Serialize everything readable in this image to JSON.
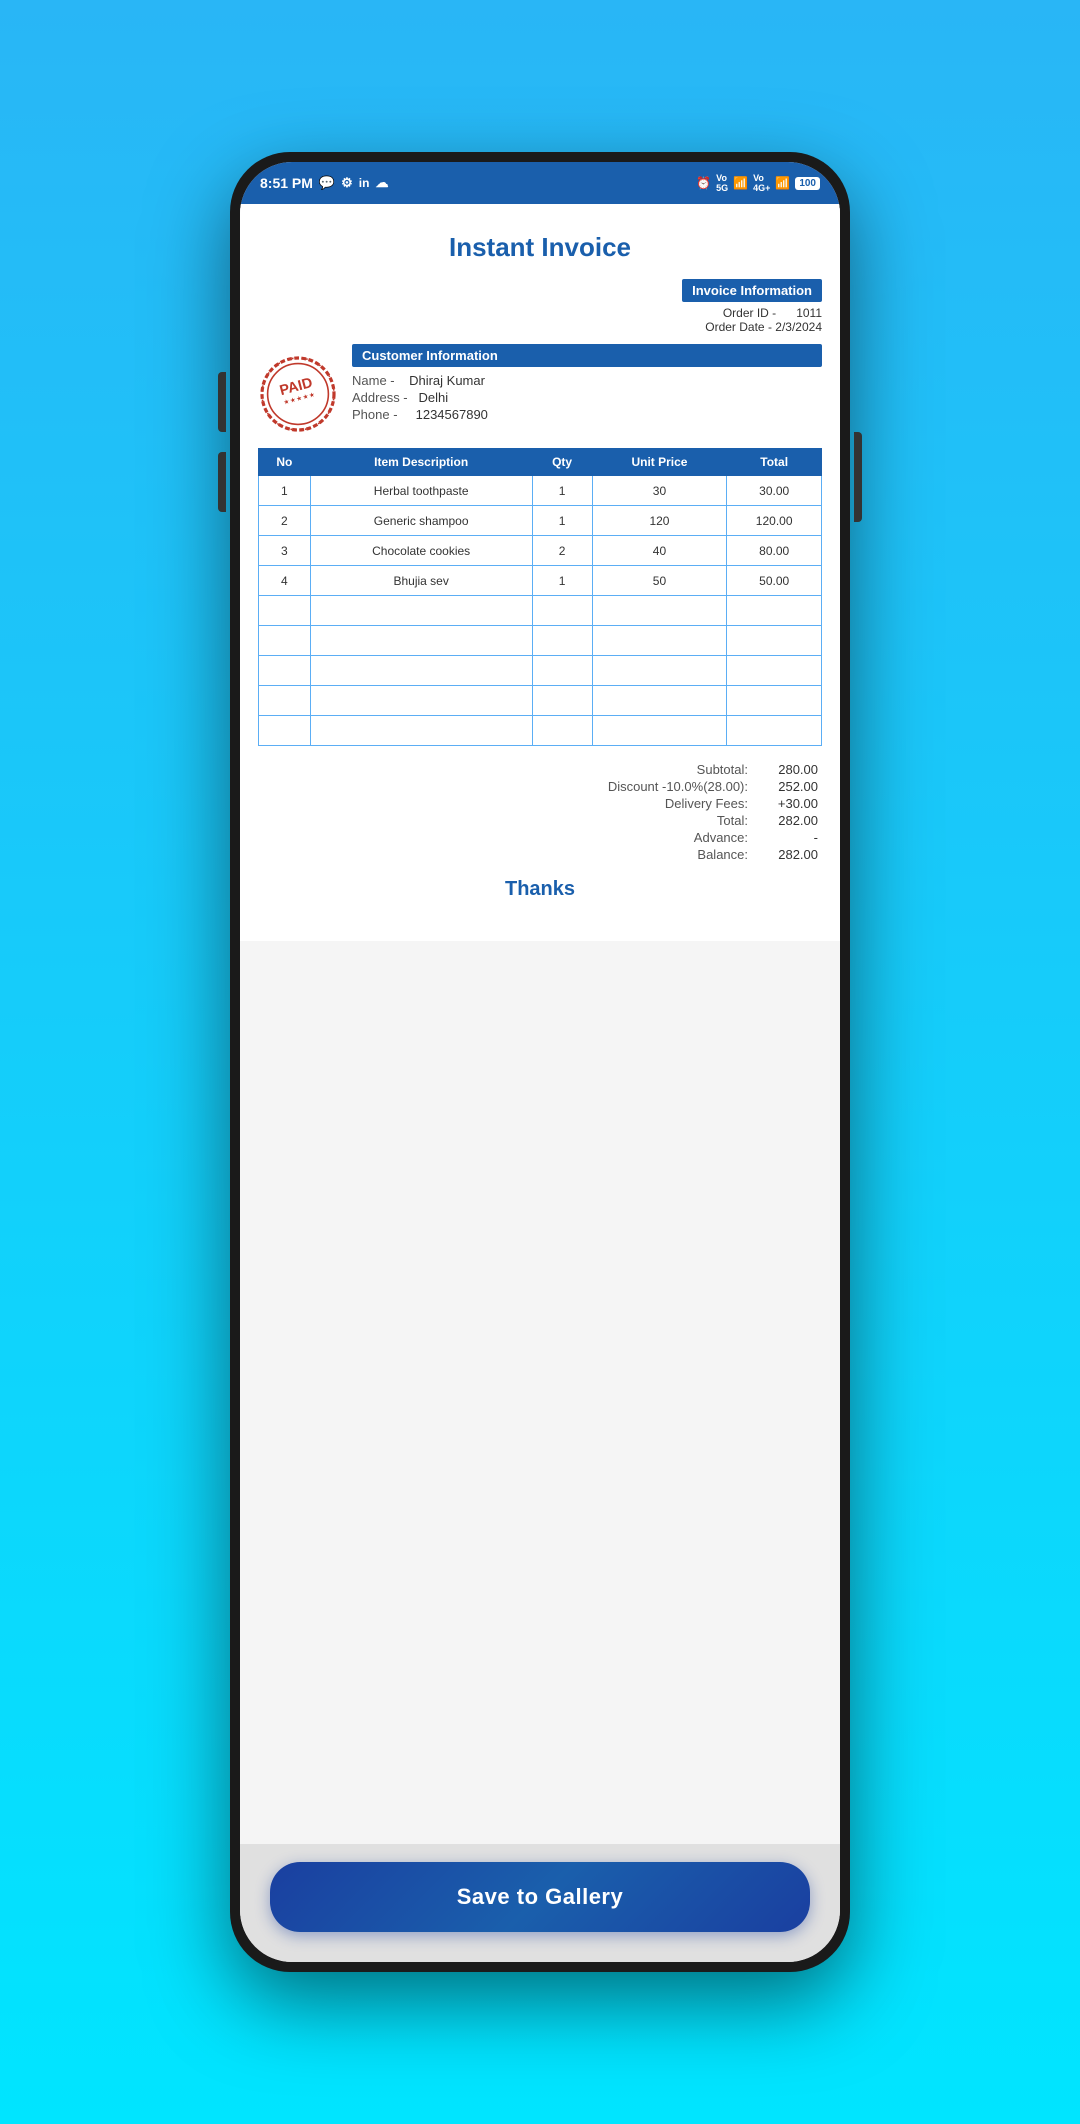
{
  "background": {
    "gradient_start": "#29b6f6",
    "gradient_end": "#00e5ff"
  },
  "status_bar": {
    "time": "8:51 PM",
    "icons_left": [
      "whatsapp",
      "settings",
      "linkedin",
      "profile"
    ],
    "icons_right": [
      "alarm",
      "5g-vo",
      "signal",
      "4g-plus-vo",
      "signal2"
    ],
    "battery": "100",
    "bg_color": "#1a5fac"
  },
  "invoice": {
    "title": "Instant Invoice",
    "invoice_info_header": "Invoice Information",
    "order_id_label": "Order ID -",
    "order_id_value": "1011",
    "order_date_label": "Order Date -",
    "order_date_value": "2/3/2024",
    "customer_info_header": "Customer Information",
    "name_label": "Name -",
    "name_value": "Dhiraj Kumar",
    "address_label": "Address -",
    "address_value": "Delhi",
    "phone_label": "Phone -",
    "phone_value": "1234567890",
    "paid_stamp_text": "PAID",
    "table": {
      "headers": [
        "No",
        "Item Description",
        "Qty",
        "Unit Price",
        "Total"
      ],
      "rows": [
        {
          "no": "1",
          "desc": "Herbal toothpaste",
          "qty": "1",
          "unit_price": "30",
          "total": "30.00"
        },
        {
          "no": "2",
          "desc": "Generic shampoo",
          "qty": "1",
          "unit_price": "120",
          "total": "120.00"
        },
        {
          "no": "3",
          "desc": "Chocolate cookies",
          "qty": "2",
          "unit_price": "40",
          "total": "80.00"
        },
        {
          "no": "4",
          "desc": "Bhujia sev",
          "qty": "1",
          "unit_price": "50",
          "total": "50.00"
        },
        {
          "no": "",
          "desc": "",
          "qty": "",
          "unit_price": "",
          "total": ""
        },
        {
          "no": "",
          "desc": "",
          "qty": "",
          "unit_price": "",
          "total": ""
        },
        {
          "no": "",
          "desc": "",
          "qty": "",
          "unit_price": "",
          "total": ""
        },
        {
          "no": "",
          "desc": "",
          "qty": "",
          "unit_price": "",
          "total": ""
        },
        {
          "no": "",
          "desc": "",
          "qty": "",
          "unit_price": "",
          "total": ""
        }
      ]
    },
    "summary": {
      "subtotal_label": "Subtotal:",
      "subtotal_value": "280.00",
      "discount_label": "Discount -10.0%(28.00):",
      "discount_value": "252.00",
      "delivery_label": "Delivery Fees:",
      "delivery_value": "+30.00",
      "total_label": "Total:",
      "total_value": "282.00",
      "advance_label": "Advance:",
      "advance_value": "-",
      "balance_label": "Balance:",
      "balance_value": "282.00"
    },
    "thanks_text": "Thanks"
  },
  "save_button": {
    "label": "Save to Gallery"
  }
}
